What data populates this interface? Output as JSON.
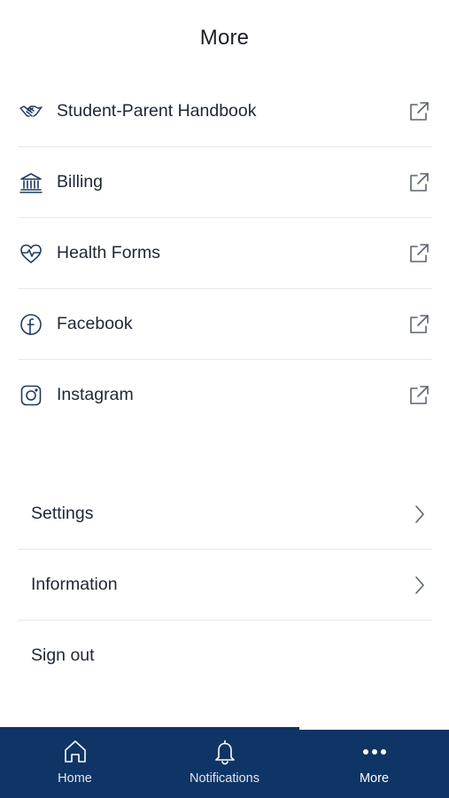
{
  "header": {
    "title": "More"
  },
  "links": [
    {
      "label": "Student-Parent Handbook",
      "icon": "handshake-icon"
    },
    {
      "label": "Billing",
      "icon": "bank-icon"
    },
    {
      "label": "Health Forms",
      "icon": "heartbeat-icon"
    },
    {
      "label": "Facebook",
      "icon": "facebook-icon"
    },
    {
      "label": "Instagram",
      "icon": "instagram-icon"
    }
  ],
  "settings": [
    {
      "label": "Settings"
    },
    {
      "label": "Information"
    },
    {
      "label": "Sign out"
    }
  ],
  "tabbar": {
    "tabs": [
      {
        "label": "Home",
        "icon": "home-icon"
      },
      {
        "label": "Notifications",
        "icon": "bell-icon"
      },
      {
        "label": "More",
        "icon": "more-dots-icon"
      }
    ],
    "active_tab": "More"
  },
  "colors": {
    "accent": "#0f3566",
    "icon_color": "#1f3a5f",
    "text": "#1f2733",
    "divider": "#e6e8eb",
    "muted_icon": "#6b7280"
  }
}
